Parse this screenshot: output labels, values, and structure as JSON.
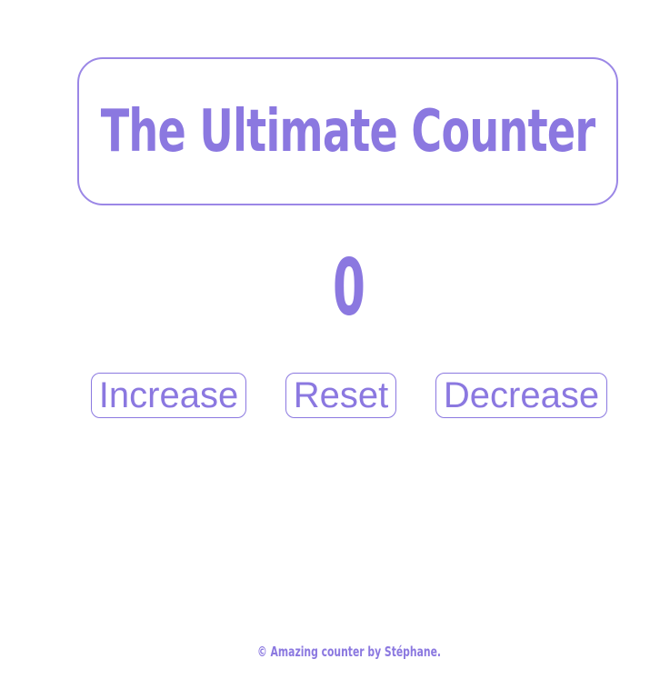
{
  "header": {
    "title": "The Ultimate Counter"
  },
  "counter": {
    "value": "0"
  },
  "buttons": {
    "increase_label": "Increase",
    "reset_label": "Reset",
    "decrease_label": "Decrease"
  },
  "footer": {
    "text": "© Amazing counter by Stéphane."
  },
  "colors": {
    "accent": "#8b78e0",
    "background": "#ffffff"
  }
}
